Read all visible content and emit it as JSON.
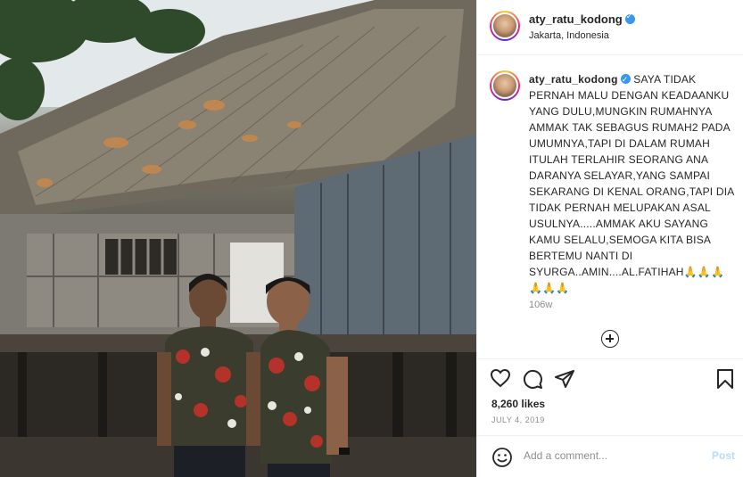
{
  "post": {
    "username": "aty_ratu_kodong",
    "location": "Jakarta, Indonesia",
    "caption": "SAYA TIDAK PERNAH MALU DENGAN KEADAANKU YANG DULU,MUNGKIN RUMAHNYA AMMAK TAK SEBAGUS RUMAH2 PADA UMUMNYA,TAPI DI DALAM RUMAH ITULAH TERLAHIR SEORANG ANA DARANYA SELAYAR,YANG SAMPAI SEKARANG DI KENAL ORANG,TAPI DIA TIDAK PERNAH MELUPAKAN ASAL USULNYA.....AMMAK AKU SAYANG KAMU SELALU,SEMOGA KITA BISA BERTEMU NANTI DI SYURGA..AMIN....AL.FATIHAH🙏🙏🙏🙏🙏🙏",
    "time_ago": "106w",
    "likes": "8,260 likes",
    "date": "JULY 4, 2019"
  },
  "comment": {
    "placeholder": "Add a comment...",
    "post_label": "Post"
  },
  "icons": {
    "like": "heart-icon",
    "comment": "comment-icon",
    "share": "share-icon",
    "save": "bookmark-icon",
    "emoji": "emoji-icon",
    "load_more": "plus-circle-icon",
    "verified": "verified-badge-icon"
  },
  "colors": {
    "verified": "#3897f0",
    "post_button": "#b2dffc",
    "muted_text": "#8e8e8e"
  }
}
